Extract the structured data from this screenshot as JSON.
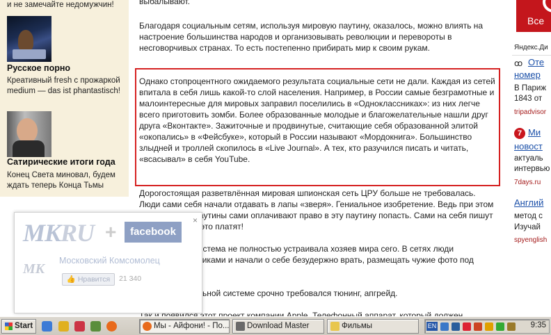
{
  "left": {
    "top_text": "и не замечайте недомужчин!",
    "item1_title": "Русское порно",
    "item1_text": "Креативный fresh с прожаркой medium — das ist phantastisch!",
    "item2_title": "Сатирические итоги года",
    "item2_text": "Конец Света миновал, будем ждать теперь Конца Тьмы"
  },
  "article": {
    "p0": "выбалывают.",
    "p1": "Благодаря социальным сетям, используя мировую паутину, оказалось, можно влиять на настроение большинства народов и организовывать революции и перевороты в несговорчивых странах. То есть постепенно прибирать мир к своим рукам.",
    "p2": "Однако стопроцентного ожидаемого результата социальные сети не дали. Каждая из сетей впитала в себя лишь какой-то слой населения. Например, в России самые безграмотные и малоинтересные для мировых заправил поселились в «Одноклассниках»: из них легче всего приготовить зомби. Более образованные молодые и благожелательные нашли друг друга «Вконтакте». Зажиточные и продвинутые, считающие себя образованной элитой «окопались» в «Фейсбуке», который в России называют «Мордокнига». Большинство злыдней и троллей скопилось в «Live Journal». А тех, кто разучился писать и читать, «всасывал» в себя YouTube.",
    "p3": "Дорогостоящая разветвлённая мировая шпионская сеть ЦРУ больше не требовалась. Люди сами себя начали отдавать в лапы «зверя». Гениальное изобретение. Ведь при этом пользователи паутины сами оплачивают право в эту паутину попасть. Сами на себя пишут досье и ещё за это платят!",
    "p4": "Однако такая система не полностью устраивала хозяев мира сего. В сетях люди прятались под никами и начали о себе безудержно врать, размещать чужие фото под чужим именем...",
    "p5": "Поэтому социальной системе срочно требовался тюнинг, апгрейд.",
    "p6": "Так и появился этот проект компании Apple. Телефонный аппарат, который должен"
  },
  "right": {
    "ad_text": "Все",
    "yandex": "Яндекс.Ди",
    "link1": "Оте",
    "link1b": "номер",
    "text1a": "В Париж",
    "text1b": "1843 от",
    "src1": "tripadvisor",
    "badge": "7",
    "link2": "Ми",
    "link2b": "новост",
    "text2a": "актуаль",
    "text2b": "интервью",
    "src2": "7days.ru",
    "link3": "Англий",
    "text3a": "метод с",
    "text3b": "Изучай",
    "src3": "spyenglish"
  },
  "popup": {
    "close": "×",
    "logo_mk": "MK",
    "logo_ru": "RU",
    "plus": "+",
    "facebook": "facebook",
    "small_logo": "MK",
    "page_name": "Московский Комсомолец",
    "like_label": "Нравится",
    "like_count": "21 340"
  },
  "taskbar": {
    "start": "Start",
    "tasks": [
      {
        "label": "Мы - Айфони! - По...",
        "active": true
      },
      {
        "label": "Download Master",
        "active": false
      },
      {
        "label": "Фильмы",
        "active": false
      }
    ],
    "lang": "EN",
    "clock": "9:35"
  }
}
